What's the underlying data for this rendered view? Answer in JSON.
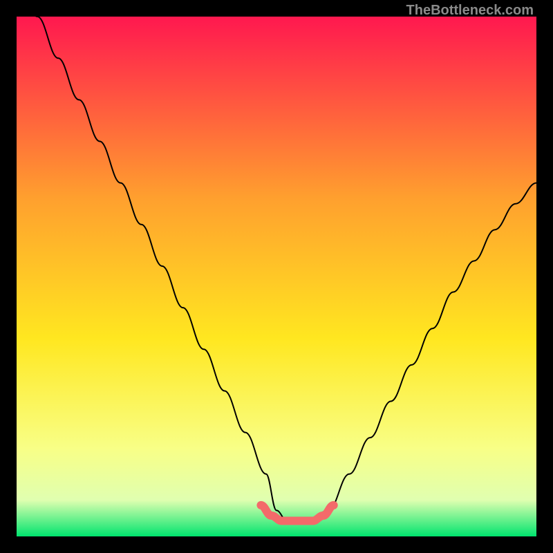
{
  "watermark": "TheBottleneck.com",
  "colors": {
    "top": "#ff184f",
    "mid1": "#ffa02e",
    "mid2": "#ffe720",
    "low": "#f8ff86",
    "pale": "#e0ffb0",
    "base": "#00e46e",
    "line": "#000000",
    "accent": "#f36a6a",
    "page_bg": "#000000"
  },
  "chart_data": {
    "type": "line",
    "title": "",
    "xlabel": "",
    "ylabel": "",
    "xlim": [
      0,
      100
    ],
    "ylim": [
      0,
      100
    ],
    "series": [
      {
        "name": "black-curve",
        "x": [
          0,
          4,
          8,
          12,
          16,
          20,
          24,
          28,
          32,
          36,
          40,
          44,
          48,
          50,
          52,
          56,
          60,
          64,
          68,
          72,
          76,
          80,
          84,
          88,
          92,
          96,
          100
        ],
        "values": [
          107,
          100,
          92,
          84,
          76,
          68,
          60,
          52,
          44,
          36,
          28,
          20,
          12,
          5,
          3,
          3,
          5,
          12,
          19,
          26,
          33,
          40,
          47,
          53,
          59,
          64,
          68
        ]
      },
      {
        "name": "accent-flat",
        "x": [
          47,
          49,
          51,
          53,
          55,
          57,
          59,
          61
        ],
        "values": [
          6,
          4,
          3,
          3,
          3,
          3,
          4,
          6
        ]
      }
    ]
  }
}
